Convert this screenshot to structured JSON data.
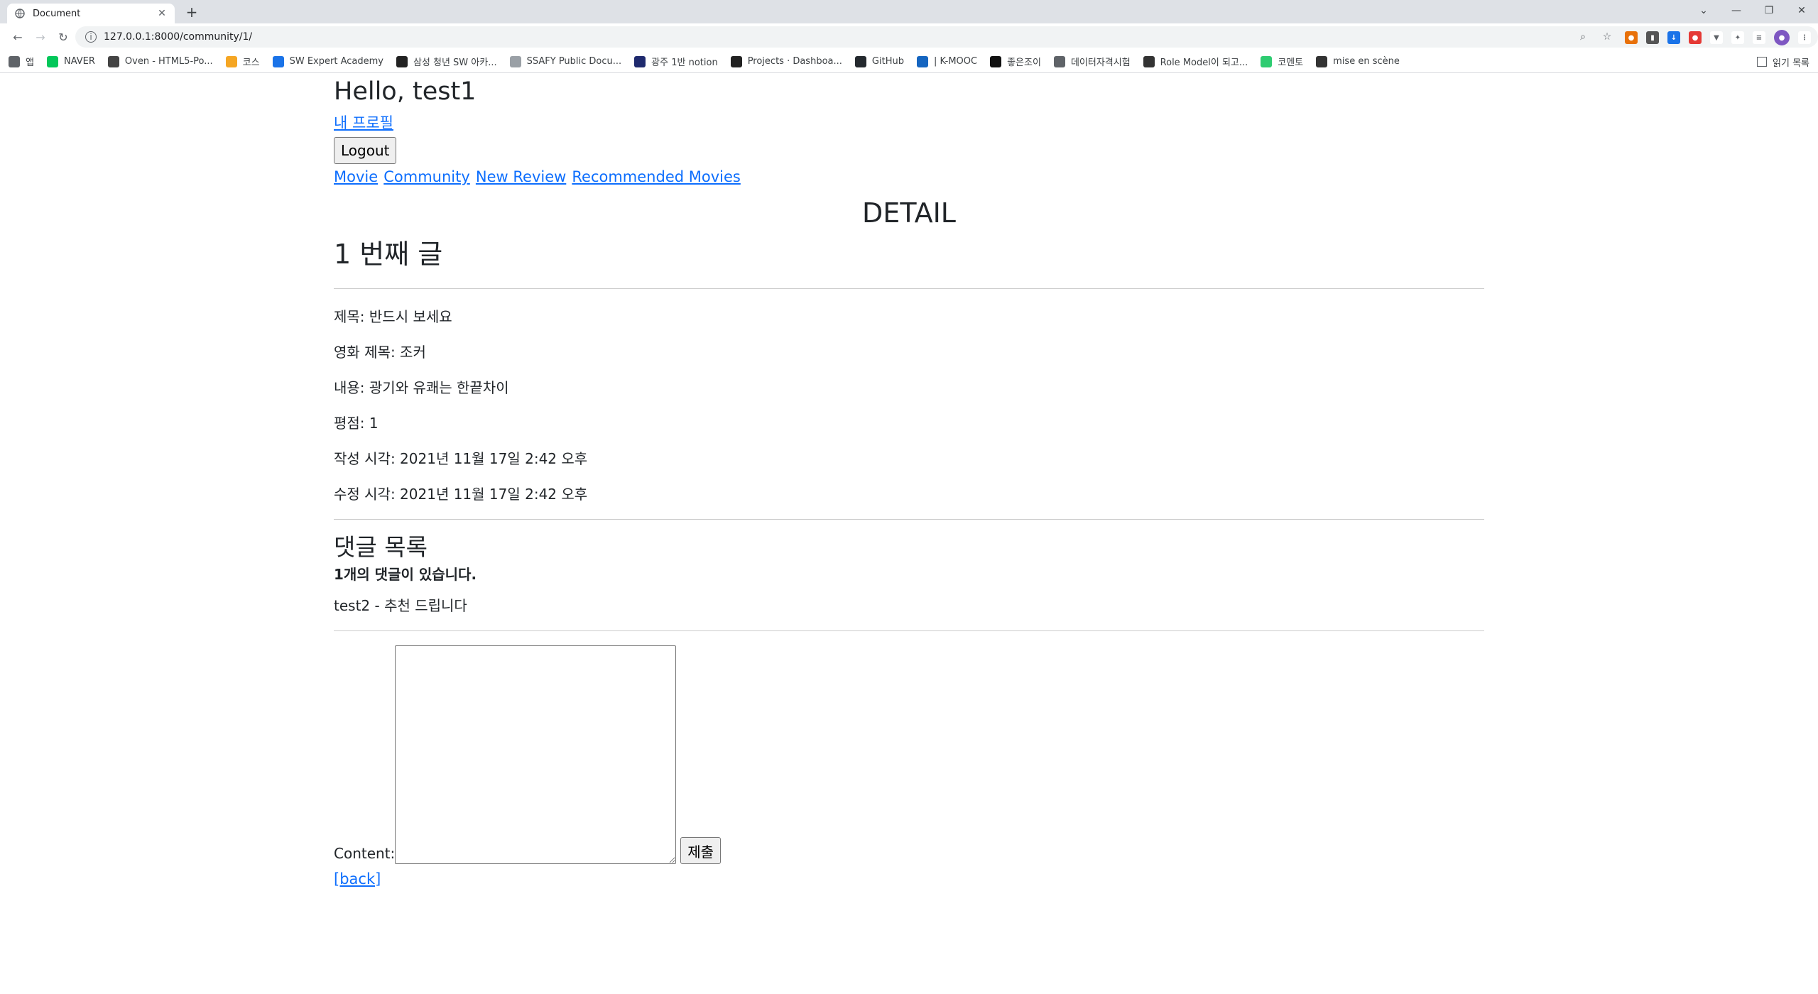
{
  "browser": {
    "tab_title": "Document",
    "url": "127.0.0.1:8000/community/1/",
    "reading_list_label": "읽기 목록",
    "bookmarks": [
      {
        "label": "앱",
        "icon": "apps-grid-icon",
        "color": "#5f6368"
      },
      {
        "label": "NAVER",
        "icon": "naver-icon",
        "color": "#03c75a"
      },
      {
        "label": "Oven - HTML5-Po...",
        "icon": "oven-icon",
        "color": "#444444"
      },
      {
        "label": "코스",
        "icon": "pencil-icon",
        "color": "#f5a623"
      },
      {
        "label": "SW Expert Academy",
        "icon": "swea-icon",
        "color": "#1a73e8"
      },
      {
        "label": "삼성 청년 SW 아카...",
        "icon": "ssafy-icon",
        "color": "#222222"
      },
      {
        "label": "SSAFY Public Docu...",
        "icon": "doc-icon",
        "color": "#9aa0a6"
      },
      {
        "label": "광주 1반 notion",
        "icon": "notion-icon",
        "color": "#1f2a6e"
      },
      {
        "label": "Projects · Dashboa...",
        "icon": "dashboard-icon",
        "color": "#222222"
      },
      {
        "label": "GitHub",
        "icon": "github-icon",
        "color": "#24292e"
      },
      {
        "label": "| K-MOOC",
        "icon": "kmooc-icon",
        "color": "#1565c0"
      },
      {
        "label": "좋은조이",
        "icon": "joy-icon",
        "color": "#111111"
      },
      {
        "label": "데이터자격시험",
        "icon": "globe-icon",
        "color": "#5f6368"
      },
      {
        "label": "Role Model이 되고...",
        "icon": "dots-icon",
        "color": "#333333"
      },
      {
        "label": "코멘토",
        "icon": "comento-icon",
        "color": "#2ecc71"
      },
      {
        "label": "mise en scène",
        "icon": "glasses-icon",
        "color": "#333333"
      }
    ]
  },
  "page": {
    "greeting": "Hello, test1",
    "profile_link": "내 프로필",
    "logout_label": "Logout",
    "nav_links": [
      "Movie",
      "Community",
      "New Review",
      "Recommended Movies"
    ],
    "detail_heading": "DETAIL",
    "article_title": "1 번째 글",
    "fields": [
      "제목: 반드시 보세요",
      "영화 제목: 조커",
      "내용: 광기와 유쾌는 한끝차이",
      "평점: 1",
      "작성 시각: 2021년 11월 17일 2:42 오후",
      "수정 시각: 2021년 11월 17일 2:42 오후"
    ],
    "comments_title": "댓글 목록",
    "comment_count": "1개의 댓글이 있습니다.",
    "comments": [
      "test2 - 추천 드립니다"
    ],
    "content_label": "Content:",
    "content_value": "",
    "submit_label": "제출",
    "back_link": "[back]"
  }
}
